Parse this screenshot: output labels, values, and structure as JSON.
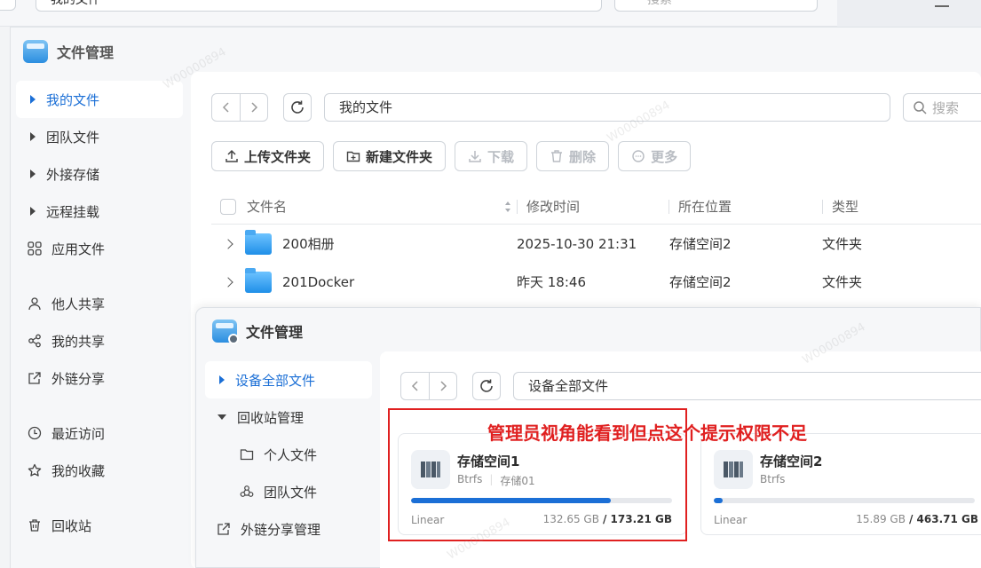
{
  "bg_window": {
    "path": "我的文件",
    "search_placeholder": "搜索"
  },
  "window1": {
    "title": "文件管理",
    "nav": [
      {
        "label": "我的文件",
        "icon": "triangle-right-icon",
        "active": true
      },
      {
        "label": "团队文件",
        "icon": "triangle-right-icon"
      },
      {
        "label": "外接存储",
        "icon": "triangle-right-icon"
      },
      {
        "label": "远程挂载",
        "icon": "triangle-right-icon"
      },
      {
        "label": "应用文件",
        "icon": "grid-icon"
      },
      {
        "label": "他人共享",
        "icon": "person-icon"
      },
      {
        "label": "我的共享",
        "icon": "share-icon"
      },
      {
        "label": "外链分享",
        "icon": "external-link-icon"
      },
      {
        "label": "最近访问",
        "icon": "clock-icon"
      },
      {
        "label": "我的收藏",
        "icon": "star-icon"
      },
      {
        "label": "回收站",
        "icon": "trash-icon"
      }
    ],
    "path": "我的文件",
    "search_placeholder": "搜索",
    "toolbar": {
      "upload": "上传文件夹",
      "new_folder": "新建文件夹",
      "download": "下载",
      "delete": "删除",
      "more": "更多"
    },
    "table": {
      "columns": [
        "文件名",
        "修改时间",
        "所在位置",
        "类型"
      ],
      "rows": [
        {
          "name": "200相册",
          "modified": "2025-10-30 21:31",
          "location": "存储空间2",
          "type": "文件夹"
        },
        {
          "name": "201Docker",
          "modified": "昨天 18:46",
          "location": "存储空间2",
          "type": "文件夹"
        }
      ]
    }
  },
  "window2": {
    "title": "文件管理",
    "nav": [
      {
        "label": "设备全部文件",
        "active": true
      },
      {
        "label": "回收站管理"
      },
      {
        "label": "个人文件"
      },
      {
        "label": "团队文件"
      },
      {
        "label": "外链分享管理"
      }
    ],
    "path": "设备全部文件",
    "storage": [
      {
        "name": "存储空间1",
        "fs": "Btrfs",
        "tag": "存储01",
        "mode": "Linear",
        "used": "132.65 GB",
        "total": "/ 173.21 GB",
        "fraction": 0.766
      },
      {
        "name": "存储空间2",
        "fs": "Btrfs",
        "tag": "",
        "mode": "Linear",
        "used": "15.89 GB",
        "total": "/ 463.71 GB",
        "fraction": 0.034
      }
    ]
  },
  "annotation": {
    "text": "管理员视角能看到但点这个提示权限不足",
    "color": "#e02020"
  },
  "colors": {
    "accent": "#1b6fd6",
    "highlight_red": "#e02020"
  }
}
